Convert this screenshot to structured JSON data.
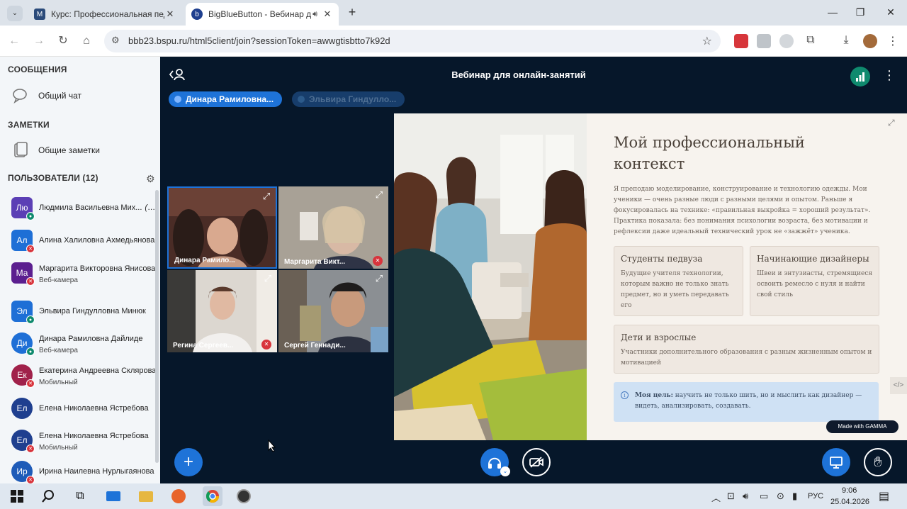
{
  "browser": {
    "tabs": [
      {
        "title": "Курс: Профессиональная педа",
        "active": false
      },
      {
        "title": "BigBlueButton - Вебинар д",
        "active": true
      }
    ],
    "new_tab": "+",
    "url": "bbb23.bspu.ru/html5client/join?sessionToken=awwgtisbtto7k92d"
  },
  "left_panel": {
    "messages_title": "СООБЩЕНИЯ",
    "public_chat": "Общий чат",
    "notes_title": "ЗАМЕТКИ",
    "shared_notes": "Общие заметки",
    "users_title": "ПОЛЬЗОВАТЕЛИ (12)",
    "users": [
      {
        "initials": "Лю",
        "name": "Людмила Васильевна Мих...",
        "you": "(Вы)",
        "sub": "",
        "color": "#5b3fb5",
        "status": "mic",
        "shape": "square"
      },
      {
        "initials": "Ал",
        "name": "Алина Халиловна Ахмедьянова",
        "you": "",
        "sub": "",
        "color": "#1e6fd6",
        "status": "muted",
        "shape": "square"
      },
      {
        "initials": "Ма",
        "name": "Маргарита Викторовна Янисова",
        "you": "",
        "sub": "Веб-камера",
        "color": "#5b1f8f",
        "status": "muted",
        "shape": "square"
      },
      {
        "initials": "Эл",
        "name": "Эльвира Гиндулловна Минюк",
        "you": "",
        "sub": "",
        "color": "#1e6fd6",
        "status": "mic",
        "shape": "square"
      },
      {
        "initials": "Ди",
        "name": "Динара Рамиловна Дайлиде",
        "you": "",
        "sub": "Веб-камера",
        "color": "#1e6fd6",
        "status": "mic",
        "shape": "round"
      },
      {
        "initials": "Ек",
        "name": "Екатерина Андреевна Склярова",
        "you": "",
        "sub": "Мобильный",
        "color": "#a0214a",
        "status": "muted",
        "shape": "round"
      },
      {
        "initials": "Ел",
        "name": "Елена Николаевна Ястребова",
        "you": "",
        "sub": "",
        "color": "#1f3f8f",
        "status": "none",
        "shape": "round"
      },
      {
        "initials": "Ел",
        "name": "Елена Николаевна Ястребова",
        "you": "",
        "sub": "Мобильный",
        "color": "#1f3f8f",
        "status": "muted",
        "shape": "round"
      },
      {
        "initials": "Ир",
        "name": "Ирина Наилевна Нурлыгаянова",
        "you": "",
        "sub": "",
        "color": "#1e5bb8",
        "status": "muted",
        "shape": "round"
      }
    ]
  },
  "meeting": {
    "title": "Вебинар для онлайн-занятий",
    "talking": [
      {
        "name": "Динара Рамиловна...",
        "active": true
      },
      {
        "name": "Эльвира Гиндулло...",
        "active": false
      }
    ],
    "cameras": [
      {
        "label": "Динара Рамило...",
        "muted": false,
        "highlighted": true,
        "bg": "#5e3a30"
      },
      {
        "label": "Маргарита Викт...",
        "muted": true,
        "highlighted": false,
        "bg": "#8a8478"
      },
      {
        "label": "Регина Сергеев...",
        "muted": true,
        "highlighted": false,
        "bg": "#c9c2bb"
      },
      {
        "label": "Сергей Геннади...",
        "muted": false,
        "highlighted": false,
        "bg": "#6c7178"
      }
    ]
  },
  "slide": {
    "title_line1": "Мой профессиональный",
    "title_line2": "контекст",
    "intro": "Я преподаю моделирование, конструирование и технологию одежды. Мои ученики — очень разные люди с разными целями и опытом. Раньше я фокусировалась на технике: «правильная выкройка = хороший результат». Практика показала: без понимания психологии возраста, без мотивации и рефлексии даже идеальный технический урок не «зажжёт» ученика.",
    "cards": [
      {
        "title": "Студенты педвуза",
        "body": "Будущие учителя технологии, которым важно не только знать предмет, но и уметь передавать его"
      },
      {
        "title": "Начинающие дизайнеры",
        "body": "Швеи и энтузиасты, стремящиеся освоить ремесло с нуля и найти свой стиль"
      },
      {
        "title": "Дети и взрослые",
        "body": "Участники дополнительного образования с разным жизненным опытом и мотивацией"
      }
    ],
    "goal_label": "Моя цель:",
    "goal_text": " научить не только шить, но и мыслить как дизайнер — видеть, анализировать, создавать.",
    "made_with": "Made with GAMMA"
  },
  "taskbar": {
    "lang": "РУС",
    "time": "9:06",
    "date": "25.04.2026"
  },
  "colors": {
    "bbb_blue": "#1e73d8",
    "muted_red": "#d8343c",
    "mic_green": "#0f8a6e",
    "main_bg": "#06172a"
  }
}
